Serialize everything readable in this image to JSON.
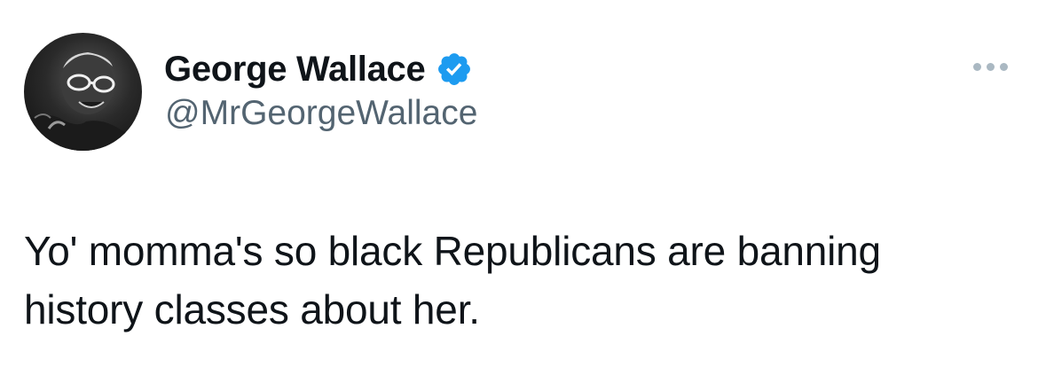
{
  "author": {
    "name": "George Wallace",
    "handle": "@MrGeorgeWallace",
    "verified": true
  },
  "tweet": {
    "lines": [
      "Yo' momma's so black Republicans are banning",
      "history classes about her."
    ]
  },
  "icons": {
    "verified": "verified-badge-icon",
    "more": "more-horizontal-icon",
    "avatar": "profile-photo"
  },
  "colors": {
    "text": "#0f1419",
    "handle": "#536471",
    "verified": "#1d9bf0",
    "more_dots": "#aab8c2",
    "background": "#ffffff"
  }
}
